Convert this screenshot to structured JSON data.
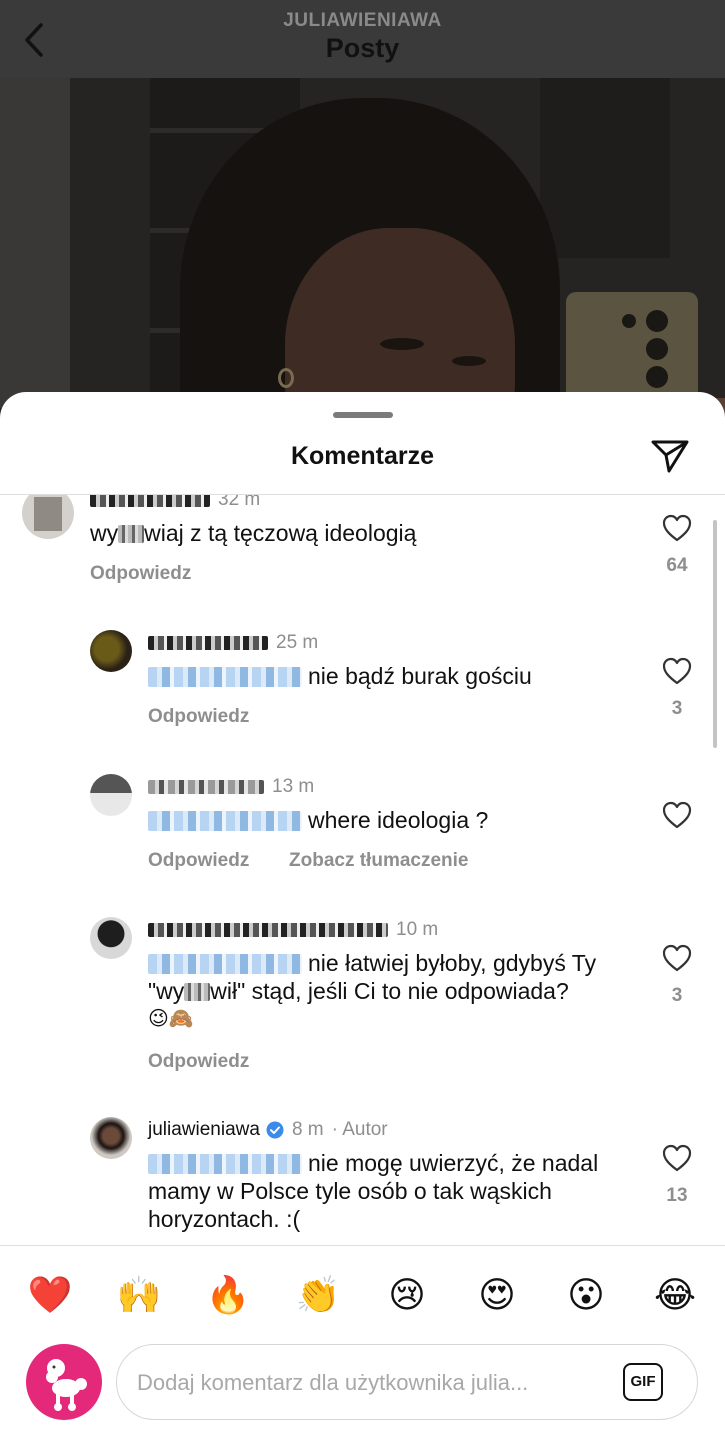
{
  "header": {
    "username": "JULIAWIENIAWA",
    "title": "Posty"
  },
  "sheet": {
    "title": "Komentarze"
  },
  "comments": [
    {
      "time": "32 m",
      "text_before": "wy",
      "text_after": "wiaj z tą tęczową ideologią",
      "reply_label": "Odpowiedz",
      "likes": "64"
    },
    {
      "time": "25 m",
      "text": "nie bądź burak gościu",
      "reply_label": "Odpowiedz",
      "likes": "3"
    },
    {
      "time": "13 m",
      "text": "where ideologia ?",
      "reply_label": "Odpowiedz",
      "translate_label": "Zobacz tłumaczenie"
    },
    {
      "time": "10 m",
      "text_line1": "nie łatwiej byłoby, gdybyś Ty",
      "text_line2_a": "\"wy",
      "text_line2_b": "wił\" stąd, jeśli Ci to nie odpowiada?",
      "emojis": "😉🙈",
      "reply_label": "Odpowiedz",
      "likes": "3"
    },
    {
      "username": "juliawieniawa",
      "time": "8 m",
      "author_tag": "· Autor",
      "text_line1": "nie mogę uwierzyć, że nadal",
      "text_line2": "mamy w Polsce tyle osób o tak wąskich",
      "text_line3": "horyzontach. :(",
      "likes": "13"
    }
  ],
  "emoji_bar": [
    "❤️",
    "🙌",
    "🔥",
    "👏",
    "😢",
    "😍",
    "😮",
    "😂"
  ],
  "input": {
    "placeholder": "Dodaj komentarz dla użytkownika julia...",
    "gif_label": "GIF"
  }
}
